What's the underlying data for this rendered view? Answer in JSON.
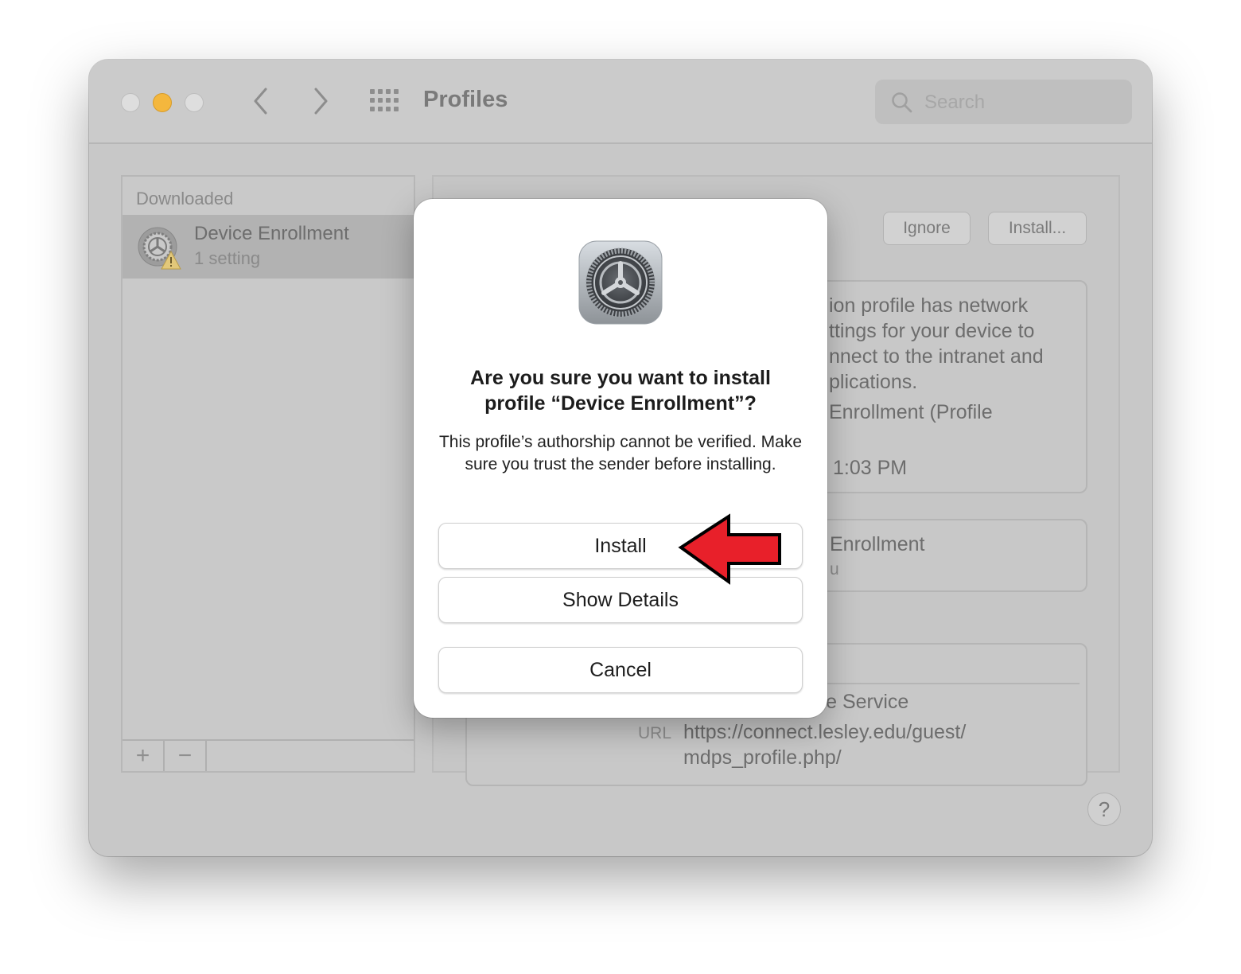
{
  "window": {
    "title": "Profiles",
    "search_placeholder": "Search"
  },
  "sidebar": {
    "header": "Downloaded",
    "items": [
      {
        "name": "Device Enrollment",
        "subtitle": "1 setting"
      }
    ],
    "add_label": "+",
    "remove_label": "−"
  },
  "detail": {
    "ignore_label": "Ignore",
    "install_label": "Install...",
    "card1_lines": [
      "ion profile has network",
      "ttings for your device to",
      "nnect to the intranet and",
      "plications.",
      "Enrollment (Profile",
      "1:03 PM"
    ],
    "card2_lines": [
      "Enrollment",
      "u"
    ],
    "card3_service": "ile Service",
    "url_label": "URL",
    "url_lines": [
      "https://connect.lesley.edu/guest/",
      "mdps_profile.php/"
    ]
  },
  "help_label": "?",
  "dialog": {
    "title": "Are you sure you want to install profile “Device Enrollment”?",
    "message": "This profile’s authorship cannot be verified. Make sure you trust the sender before installing.",
    "install_label": "Install",
    "details_label": "Show Details",
    "cancel_label": "Cancel"
  },
  "colors": {
    "annotation_arrow": "#e8202a",
    "close_light": "#dedede",
    "minimize_light": "#f4b73d"
  }
}
